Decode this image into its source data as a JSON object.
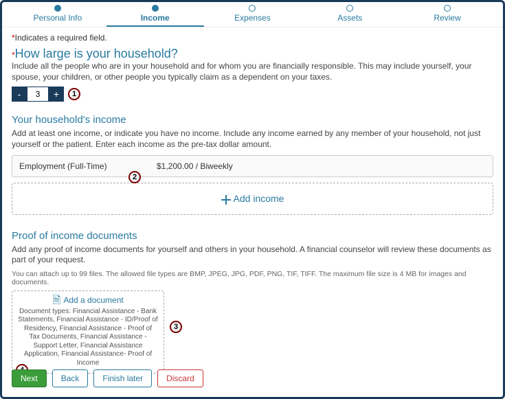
{
  "progress": {
    "steps": [
      "Personal Info",
      "Income",
      "Expenses",
      "Assets",
      "Review"
    ],
    "active_index": 1
  },
  "required_note": "Indicates a required field.",
  "household": {
    "title": "How large is your household?",
    "helper": "Include all the people who are in your household and for whom you are financially responsible. This may include yourself, your spouse, your children, or other people you typically claim as a dependent on your taxes.",
    "value": "3"
  },
  "income": {
    "title": "Your household's income",
    "helper": "Add at least one income, or indicate you have no income. Include any income earned by any member of your household, not just yourself or the patient. Enter each income as the pre-tax dollar amount.",
    "row": {
      "type": "Employment (Full-Time)",
      "amount": "$1,200.00 / Biweekly"
    },
    "add_label": "Add income"
  },
  "proof": {
    "title": "Proof of income documents",
    "helper": "Add any proof of income documents for yourself and others in your household. A financial counselor will review these documents as part of your request.",
    "rules": "You can attach up to 99 files. The allowed file types are BMP, JPEG, JPG, PDF, PNG, TIF, TIFF. The maximum file size is 4 MB for images and documents.",
    "add_label": "Add a document",
    "doc_types": "Document types: Financial Assistance - Bank Statements, Financial Assistance - ID/Proof of Residency, Financial Assistance - Proof of Tax Documents, Financial Assistance - Support Letter, Financial Assistance Application, Financial Assistance- Proof of Income"
  },
  "buttons": {
    "next": "Next",
    "back": "Back",
    "finish": "Finish later",
    "discard": "Discard"
  },
  "callouts": [
    "1",
    "2",
    "3",
    "4"
  ]
}
